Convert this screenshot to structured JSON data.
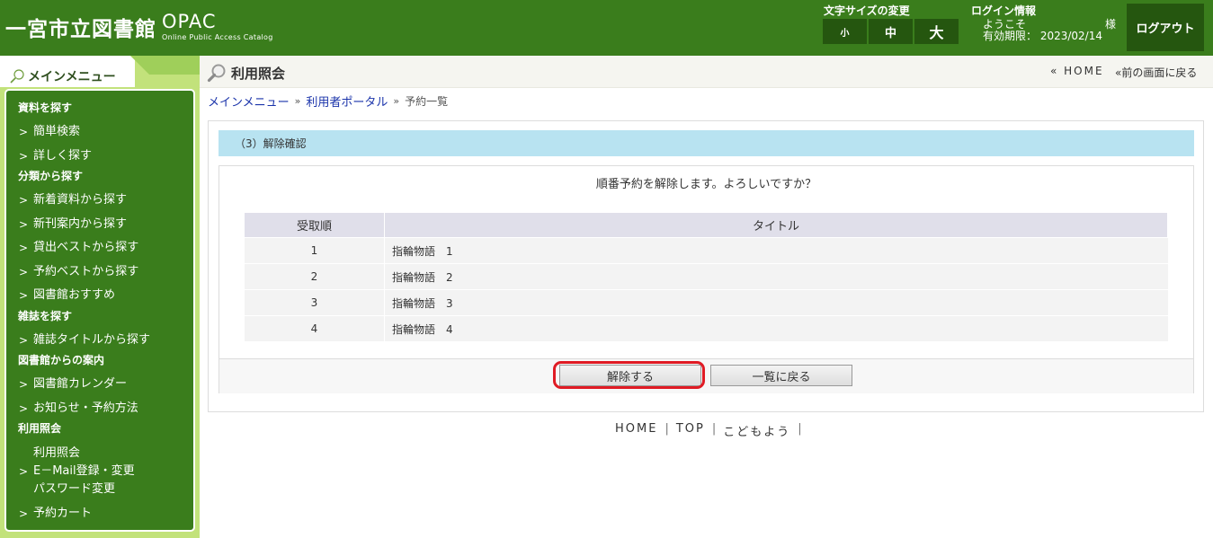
{
  "header": {
    "logo_main": "一宮市立図書館",
    "logo_opac": "OPAC",
    "logo_sub": "Online Public Access Catalog",
    "font_size_label": "文字サイズの変更",
    "font_sizes": [
      "小",
      "中",
      "大"
    ],
    "login_title": "ログイン情報",
    "login_welcome": "ようこそ",
    "login_sama": "様",
    "login_expiry": "有効期限： 2023/02/14",
    "logout": "ログアウト"
  },
  "sidebar": {
    "title": "メインメニュー",
    "categories": [
      "資料を探す",
      "分類から探す",
      "雑誌を探す",
      "図書館からの案内",
      "利用照会"
    ],
    "items": [
      "簡単検索",
      "詳しく探す",
      "新着資料から探す",
      "新刊案内から探す",
      "貸出ベストから探す",
      "予約ベストから探す",
      "図書館おすすめ",
      "雑誌タイトルから探す",
      "図書館カレンダー",
      "お知らせ・予約方法",
      "利用照会",
      "E－Mail登録・変更",
      "パスワード変更",
      "予約カート"
    ]
  },
  "titlebar": {
    "title": "利用照会",
    "home": "« HOME",
    "back": "«前の画面に戻る"
  },
  "breadcrumb": {
    "main_menu": "メインメニュー",
    "sep": "»",
    "portal": "利用者ポータル",
    "current": "予約一覧"
  },
  "content": {
    "step": "（3）解除確認",
    "message": "順番予約を解除します。よろしいですか？",
    "columns": [
      "受取順",
      "タイトル"
    ],
    "rows": [
      {
        "order": "1",
        "title": "指輪物語　1"
      },
      {
        "order": "2",
        "title": "指輪物語　2"
      },
      {
        "order": "3",
        "title": "指輪物語　3"
      },
      {
        "order": "4",
        "title": "指輪物語　4"
      }
    ],
    "cancel_button": "解除する",
    "back_button": "一覧に戻る"
  },
  "footer": {
    "links": [
      "HOME",
      "TOP",
      "こどもよう"
    ],
    "sep": "|"
  },
  "colors": {
    "header_green": "#3a7d1c",
    "dark_green": "#25560f",
    "sidebar_light": "#c2e27b",
    "step_blue": "#b8e3f1",
    "highlight_red": "#e01b24",
    "link_blue": "#1a33aa"
  }
}
